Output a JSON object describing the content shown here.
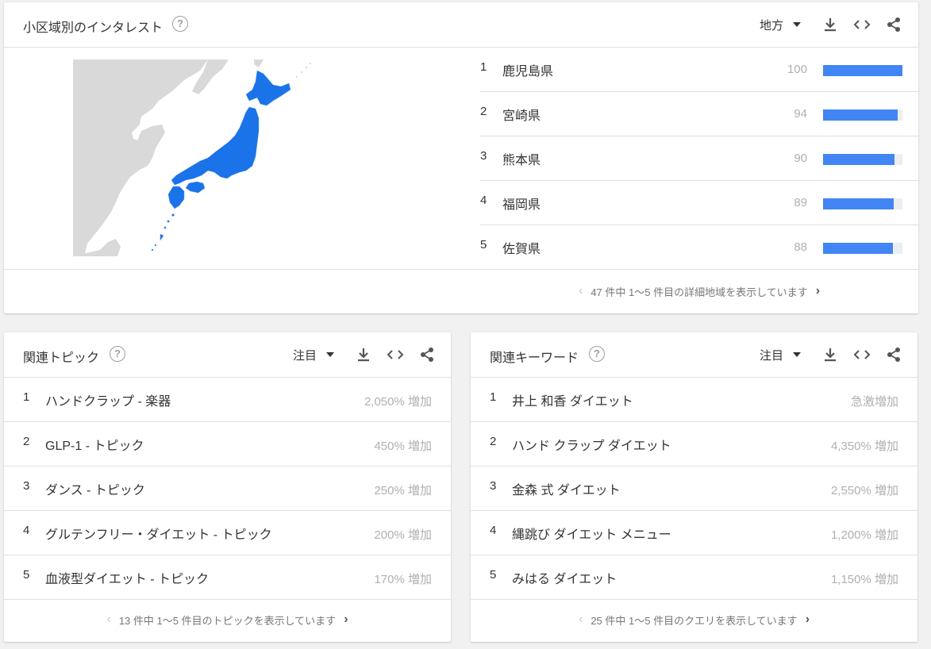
{
  "region": {
    "title": "小区域別のインタレスト",
    "filter_label": "地方",
    "rows": [
      {
        "rank": "1",
        "name": "鹿児島県",
        "value": "100",
        "fill": 1.0
      },
      {
        "rank": "2",
        "name": "宮崎県",
        "value": "94",
        "fill": 0.94
      },
      {
        "rank": "3",
        "name": "熊本県",
        "value": "90",
        "fill": 0.9
      },
      {
        "rank": "4",
        "name": "福岡県",
        "value": "89",
        "fill": 0.89
      },
      {
        "rank": "5",
        "name": "佐賀県",
        "value": "88",
        "fill": 0.88
      }
    ],
    "footer": "47 件中 1〜5 件目の詳細地域を表示しています",
    "bar_color": "#4285f4",
    "map_fill_color": "#1a73e8"
  },
  "topics": {
    "title": "関連トピック",
    "filter_label": "注目",
    "rows": [
      {
        "rank": "1",
        "name": "ハンドクラップ - 楽器",
        "value": "2,050% 増加"
      },
      {
        "rank": "2",
        "name": "GLP-1 - トピック",
        "value": "450% 増加"
      },
      {
        "rank": "3",
        "name": "ダンス - トピック",
        "value": "250% 増加"
      },
      {
        "rank": "4",
        "name": "グルテンフリー・ダイエット - トピック",
        "value": "200% 増加"
      },
      {
        "rank": "5",
        "name": "血液型ダイエット - トピック",
        "value": "170% 増加"
      }
    ],
    "footer": "13 件中 1〜5 件目のトピックを表示しています"
  },
  "keywords": {
    "title": "関連キーワード",
    "filter_label": "注目",
    "rows": [
      {
        "rank": "1",
        "name": "井上 和香 ダイエット",
        "value": "急激増加"
      },
      {
        "rank": "2",
        "name": "ハンド クラップ ダイエット",
        "value": "4,350% 増加"
      },
      {
        "rank": "3",
        "name": "金森 式 ダイエット",
        "value": "2,550% 増加"
      },
      {
        "rank": "4",
        "name": "縄跳び ダイエット メニュー",
        "value": "1,200% 増加"
      },
      {
        "rank": "5",
        "name": "みはる ダイエット",
        "value": "1,150% 増加"
      }
    ],
    "footer": "25 件中 1〜5 件目のクエリを表示しています"
  },
  "icons": {
    "help": "?",
    "prev": "‹",
    "next": "›"
  }
}
